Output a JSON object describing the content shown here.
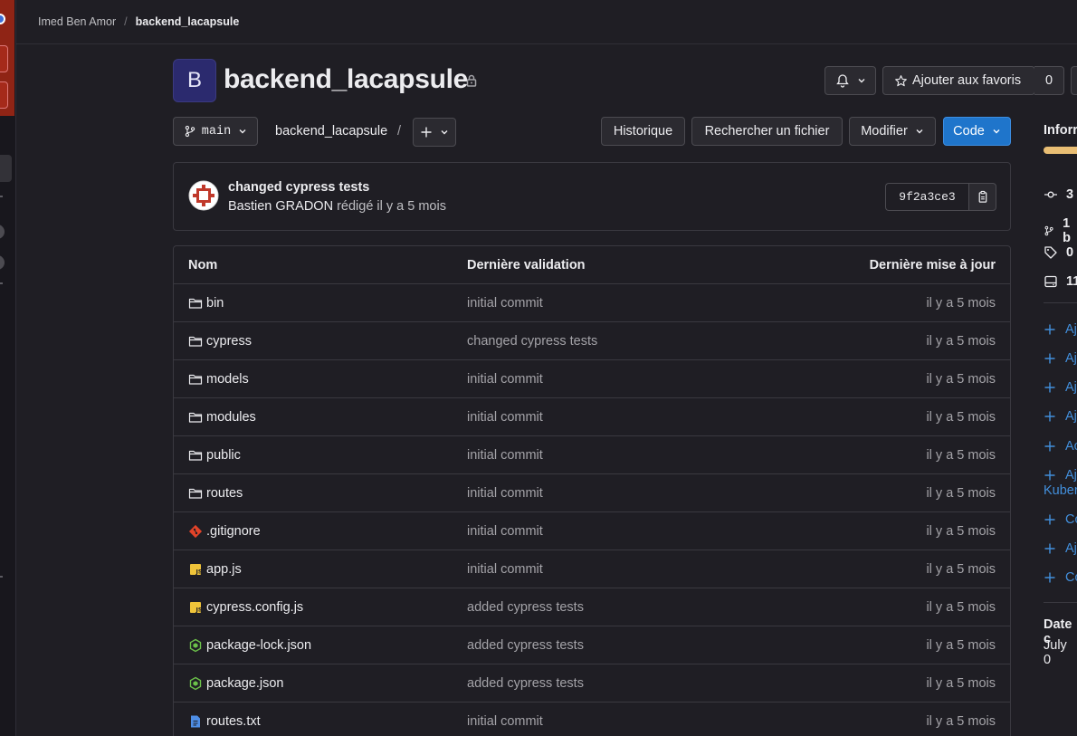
{
  "breadcrumb": {
    "owner": "Imed Ben Amor",
    "separator": "/",
    "project": "backend_lacapsule"
  },
  "repo": {
    "avatar_letter": "B",
    "title": "backend_lacapsule",
    "favorite_label": "Ajouter aux favoris",
    "favorite_count": "0"
  },
  "toolbar": {
    "branch": "main",
    "path": "backend_lacapsule",
    "path_sep": "/",
    "history_label": "Historique",
    "find_file_label": "Rechercher un fichier",
    "edit_label": "Modifier",
    "code_label": "Code"
  },
  "commit": {
    "title": "changed cypress tests",
    "author": "Bastien GRADON",
    "meta": "rédigé il y a 5 mois",
    "sha": "9f2a3ce3"
  },
  "table": {
    "headers": {
      "name": "Nom",
      "last_commit": "Dernière validation",
      "last_update": "Dernière mise à jour"
    },
    "rows": [
      {
        "name": "bin",
        "icon": "folder-icon",
        "commit": "initial commit",
        "date": "il y a 5 mois"
      },
      {
        "name": "cypress",
        "icon": "folder-icon",
        "commit": "changed cypress tests",
        "date": "il y a 5 mois"
      },
      {
        "name": "models",
        "icon": "folder-icon",
        "commit": "initial commit",
        "date": "il y a 5 mois"
      },
      {
        "name": "modules",
        "icon": "folder-icon",
        "commit": "initial commit",
        "date": "il y a 5 mois"
      },
      {
        "name": "public",
        "icon": "folder-icon",
        "commit": "initial commit",
        "date": "il y a 5 mois"
      },
      {
        "name": "routes",
        "icon": "folder-icon",
        "commit": "initial commit",
        "date": "il y a 5 mois"
      },
      {
        "name": ".gitignore",
        "icon": "git-icon",
        "commit": "initial commit",
        "date": "il y a 5 mois"
      },
      {
        "name": "app.js",
        "icon": "js-icon",
        "commit": "initial commit",
        "date": "il y a 5 mois"
      },
      {
        "name": "cypress.config.js",
        "icon": "js-icon",
        "commit": "added cypress tests",
        "date": "il y a 5 mois"
      },
      {
        "name": "package-lock.json",
        "icon": "node-icon",
        "commit": "added cypress tests",
        "date": "il y a 5 mois"
      },
      {
        "name": "package.json",
        "icon": "node-icon",
        "commit": "added cypress tests",
        "date": "il y a 5 mois"
      },
      {
        "name": "routes.txt",
        "icon": "text-file-icon",
        "commit": "initial commit",
        "date": "il y a 5 mois"
      }
    ]
  },
  "sidebar": {
    "info_title": "Inforr",
    "stats": [
      {
        "icon": "commit-icon",
        "value": "3"
      },
      {
        "icon": "branch-icon",
        "value": "1 b"
      },
      {
        "icon": "tag-icon",
        "value": "0"
      },
      {
        "icon": "storage-icon",
        "value": "11"
      }
    ],
    "add_links": [
      {
        "label": "Aj"
      },
      {
        "label": "Aj"
      },
      {
        "label": "Aj"
      },
      {
        "label": "Aj"
      },
      {
        "label": "Ac"
      },
      {
        "label": "Aj"
      },
      {
        "label": "Co"
      },
      {
        "label": "Aj"
      },
      {
        "label": "Co"
      }
    ],
    "kubernetes_fragment": "Kuber",
    "date_title": "Date c",
    "date_value": "July 0"
  },
  "colors": {
    "accent": "#1f75cb",
    "link": "#428fdc",
    "brand_red": "#8f2415",
    "progress": "#e9be74"
  }
}
